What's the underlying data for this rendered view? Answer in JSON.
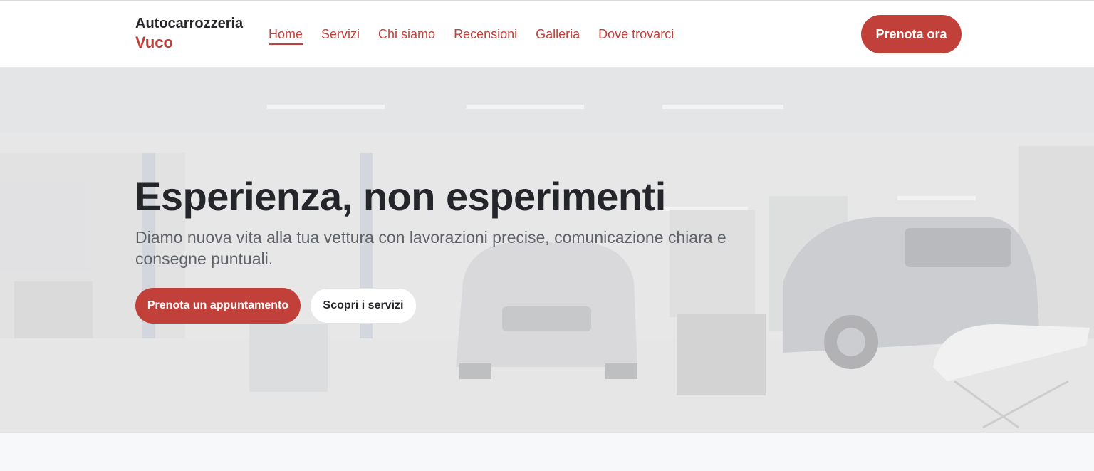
{
  "brand": {
    "line1": "Autocarrozzeria",
    "line2": "Vuco"
  },
  "nav": [
    {
      "label": "Home",
      "active": true
    },
    {
      "label": "Servizi"
    },
    {
      "label": "Chi siamo"
    },
    {
      "label": "Recensioni"
    },
    {
      "label": "Galleria"
    },
    {
      "label": "Dove trovarci"
    }
  ],
  "header_cta": "Prenota ora",
  "hero": {
    "title": "Esperienza, non esperimenti",
    "subtitle": "Diamo nuova vita alla tua vettura con lavorazioni precise, comunicazione chiara e consegne puntuali.",
    "primary_button": "Prenota un appuntamento",
    "secondary_button": "Scopri i servizi",
    "background": "garage-workshop-photo"
  },
  "colors": {
    "accent": "#c2403a",
    "text": "#25262a",
    "muted": "#5f6369"
  }
}
